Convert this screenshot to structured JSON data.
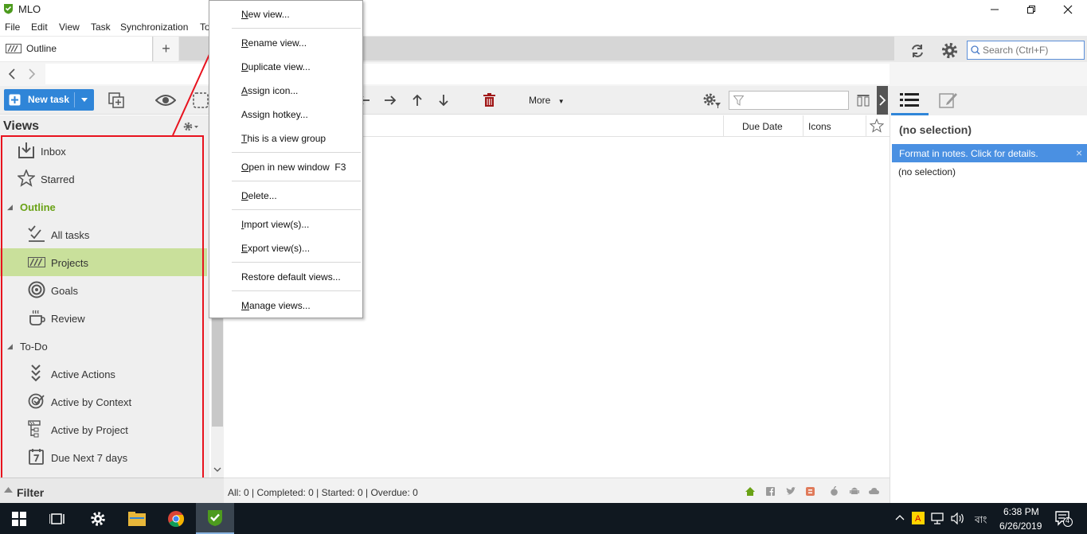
{
  "window": {
    "title": "MLO"
  },
  "menubar": {
    "items": [
      "File",
      "Edit",
      "View",
      "Task",
      "Synchronization",
      "To"
    ]
  },
  "tabs": {
    "active_label": "Outline",
    "add_label": "+"
  },
  "search": {
    "placeholder": "Search (Ctrl+F)"
  },
  "toolbar": {
    "new_task_label": "New task",
    "more_label": "More"
  },
  "views_panel": {
    "title": "Views",
    "items": [
      {
        "label": "Inbox",
        "icon": "inbox-icon"
      },
      {
        "label": "Starred",
        "icon": "star-icon"
      },
      {
        "label": "Outline",
        "group": true
      },
      {
        "label": "All tasks",
        "icon": "all-tasks-icon"
      },
      {
        "label": "Projects",
        "icon": "projects-icon",
        "selected": true
      },
      {
        "label": "Goals",
        "icon": "goals-icon"
      },
      {
        "label": "Review",
        "icon": "review-icon"
      },
      {
        "label": "To-Do",
        "group": true
      },
      {
        "label": "Active Actions",
        "icon": "active-actions-icon"
      },
      {
        "label": "Active by Context",
        "icon": "context-icon"
      },
      {
        "label": "Active by Project",
        "icon": "project-tree-icon"
      },
      {
        "label": "Due Next 7 days",
        "icon": "calendar-icon"
      }
    ]
  },
  "filter_bar": {
    "label": "Filter"
  },
  "list": {
    "columns": [
      "Due Date",
      "Icons"
    ]
  },
  "status_bar": {
    "text": "All: 0 | Completed: 0 | Started: 0 | Overdue: 0"
  },
  "right_panel": {
    "title": "(no selection)",
    "notes_hint": "Format in notes. Click  for details.",
    "subtitle": "(no selection)"
  },
  "context_menu": {
    "items": [
      {
        "label": "New view...",
        "u": "N"
      },
      {
        "label": "Rename view...",
        "u": "R"
      },
      {
        "label": "Duplicate view...",
        "u": "D"
      },
      {
        "label": "Assign icon...",
        "u": "A"
      },
      {
        "label": "Assign hotkey...",
        "u": "h"
      },
      {
        "label": "This is a view group",
        "u": "T"
      },
      {
        "label": "Open in new window  F3",
        "u": "O"
      },
      {
        "label": "Delete...",
        "u": "D"
      },
      {
        "label": "Import view(s)...",
        "u": "I"
      },
      {
        "label": "Export view(s)...",
        "u": "E"
      },
      {
        "label": "Restore default views...",
        "u": ""
      },
      {
        "label": "Manage views...",
        "u": "M"
      }
    ]
  },
  "taskbar": {
    "time": "6:38 PM",
    "date": "6/26/2019",
    "language": "বাং",
    "notification_count": "4"
  },
  "colors": {
    "accent_blue": "#2f85d8",
    "selected_green": "#c9e09b",
    "outline_green": "#6aa216",
    "annotation_red": "#e8121e"
  }
}
